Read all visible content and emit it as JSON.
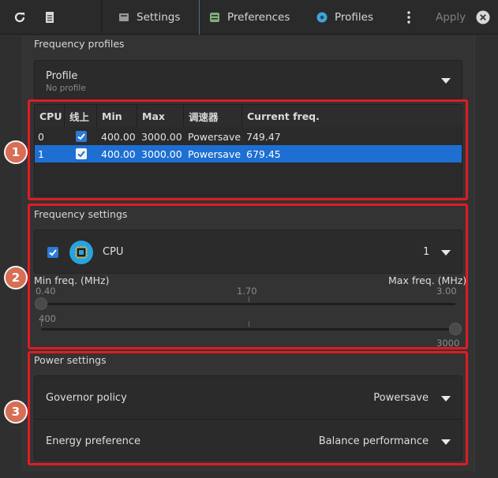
{
  "toolbar": {
    "tabs": [
      "Settings",
      "Preferences",
      "Profiles"
    ],
    "apply_label": "Apply"
  },
  "profiles_section": {
    "title": "Frequency profiles",
    "profile_label": "Profile",
    "profile_value": "No profile"
  },
  "table": {
    "headers": [
      "CPU",
      "线上",
      "Min",
      "Max",
      "调速器",
      "Current freq."
    ],
    "rows": [
      {
        "cpu": "0",
        "online": true,
        "min": "400.00",
        "max": "3000.00",
        "governor": "Powersave",
        "current": "749.47",
        "selected": false
      },
      {
        "cpu": "1",
        "online": true,
        "min": "400.00",
        "max": "3000.00",
        "governor": "Powersave",
        "current": "679.45",
        "selected": true
      }
    ]
  },
  "frequency_settings": {
    "title": "Frequency settings",
    "cpu_label": "CPU",
    "cpu_value": "1",
    "min_label": "Min freq. (MHz)",
    "max_label": "Max freq. (MHz)",
    "scale_low": "0.40",
    "scale_mid": "1.70",
    "scale_high": "3.00",
    "min_value": "400",
    "max_value": "3000",
    "min_slider_fraction": 0.0,
    "max_slider_fraction": 1.0
  },
  "power_settings": {
    "title": "Power settings",
    "governor_label": "Governor policy",
    "governor_value": "Powersave",
    "energy_label": "Energy preference",
    "energy_value": "Balance performance"
  },
  "annotations": [
    "1",
    "2",
    "3"
  ],
  "colors": {
    "accent": "#1d6fd1",
    "annotation_red": "#e01b24",
    "badge": "#d76e55",
    "cpu_icon": "#28a3e0"
  }
}
